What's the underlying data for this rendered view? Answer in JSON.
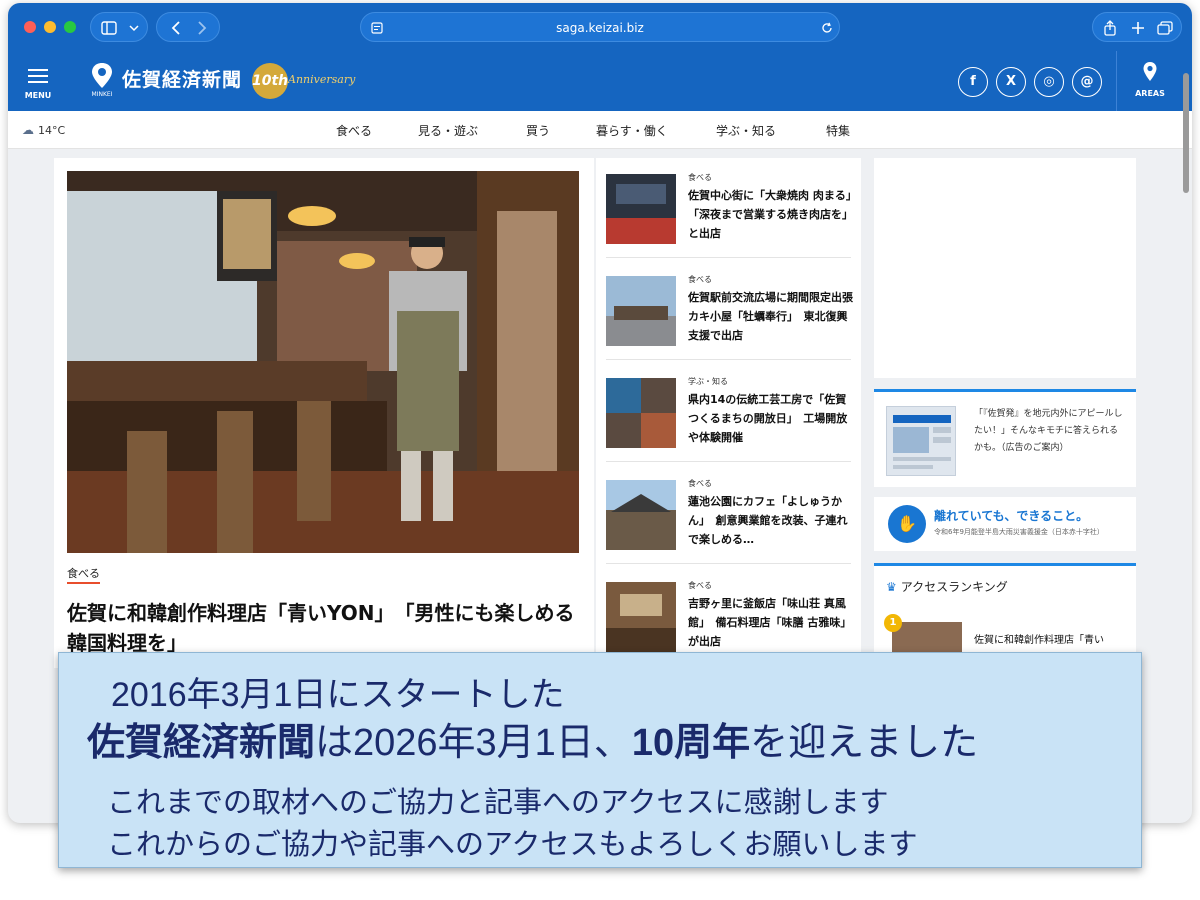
{
  "browser": {
    "url": "saga.keizai.biz",
    "icons": [
      "sidebar-icon",
      "chevron-down-icon",
      "back-icon",
      "forward-icon",
      "reader-icon",
      "reload-icon",
      "share-icon",
      "new-tab-icon",
      "tabs-overview-icon"
    ]
  },
  "header": {
    "menu_label": "MENU",
    "minkei_label": "MINKEI",
    "site_name": "佐賀経済新聞",
    "anniversary_num": "10th",
    "anniversary_text": "Anniversary",
    "social": [
      "f",
      "X",
      "◎",
      "@"
    ],
    "areas_label": "AREAS",
    "brand_color": "#1565c0"
  },
  "nav": {
    "weather": "14°C",
    "categories": [
      "食べる",
      "見る・遊ぶ",
      "買う",
      "暮らす・働く",
      "学ぶ・知る",
      "特集"
    ]
  },
  "main_article": {
    "tag": "食べる",
    "title": "佐賀に和韓創作料理店「青いYON」　「男性にも楽しめる韓国料理を」"
  },
  "articles": [
    {
      "tag": "食べる",
      "title": "佐賀中心街に「大衆焼肉 肉まる」　「深夜まで営業する焼き肉店を」と出店"
    },
    {
      "tag": "食べる",
      "title": "佐賀駅前交流広場に期間限定出張カキ小屋「牡蠣奉行」　東北復興支援で出店"
    },
    {
      "tag": "学ぶ・知る",
      "title": "県内14の伝統工芸工房で「佐賀つくるまちの開放日」　工場開放や体験開催"
    },
    {
      "tag": "食べる",
      "title": "蓮池公園にカフェ「よしゅうかん」　創意興業館を改装、子連れで楽しめる…"
    },
    {
      "tag": "食べる",
      "title": "吉野ヶ里に釜飯店「味山荘 真風館」　備石料理店「味膳 古雅味」が出店"
    }
  ],
  "sidebar": {
    "pr_text": "「『佐賀発』を地元内外にアピールしたい！」そんなキモチに答えられるかも。（広告のご案内）",
    "donate_title": "離れていても、できること。",
    "donate_sub": "令和6年9月能登半島大雨災害義援金（日本赤十字社）",
    "ranking_title": "アクセスランキング",
    "ranking_num": "1",
    "ranking_item": "佐賀に和韓創作料理店「青いYON」　「男性にも楽しめ…"
  },
  "banner": {
    "line1": "2016年3月1日にスタートした",
    "line2_name": "佐賀経済新聞",
    "line2_mid": "は2026年3月1日、",
    "line2_years": "10周年",
    "line2_end": "を迎えました",
    "line3": "これまでの取材へのご協力と記事へのアクセスに感謝します",
    "line4": "これからのご協力や記事へのアクセスもよろしくお願いします"
  }
}
